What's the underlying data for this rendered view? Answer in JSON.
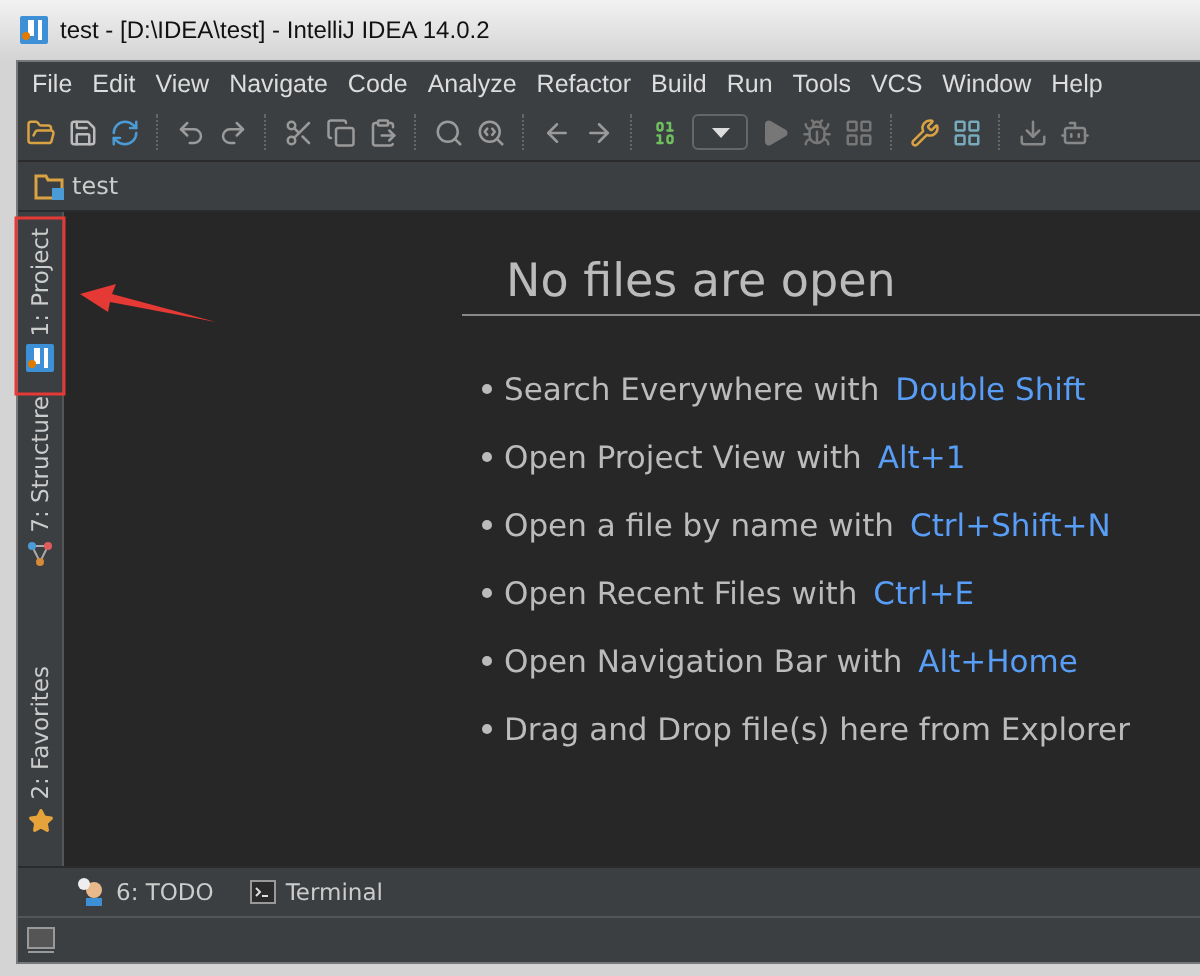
{
  "window": {
    "title": "test - [D:\\IDEA\\test] - IntelliJ IDEA 14.0.2"
  },
  "menu": [
    "File",
    "Edit",
    "View",
    "Navigate",
    "Code",
    "Analyze",
    "Refactor",
    "Build",
    "Run",
    "Tools",
    "VCS",
    "Window",
    "Help"
  ],
  "breadcrumb": [
    "test"
  ],
  "side_tabs": [
    {
      "label": "1: Project",
      "kind": "logo"
    },
    {
      "label": "7: Structure",
      "kind": "structure"
    },
    {
      "label": "2: Favorites",
      "kind": "star"
    }
  ],
  "editor": {
    "heading": "No files are open",
    "hints": [
      {
        "text": "Search Everywhere with",
        "shortcut": "Double Shift"
      },
      {
        "text": "Open Project View with",
        "shortcut": "Alt+1"
      },
      {
        "text": "Open a file by name with",
        "shortcut": "Ctrl+Shift+N"
      },
      {
        "text": "Open Recent Files with",
        "shortcut": "Ctrl+E"
      },
      {
        "text": "Open Navigation Bar with",
        "shortcut": "Alt+Home"
      },
      {
        "text": "Drag and Drop file(s) here from Explorer"
      }
    ]
  },
  "bottom_tabs": [
    {
      "label": "6: TODO",
      "kind": "todo"
    },
    {
      "label": "Terminal",
      "kind": "terminal"
    }
  ]
}
